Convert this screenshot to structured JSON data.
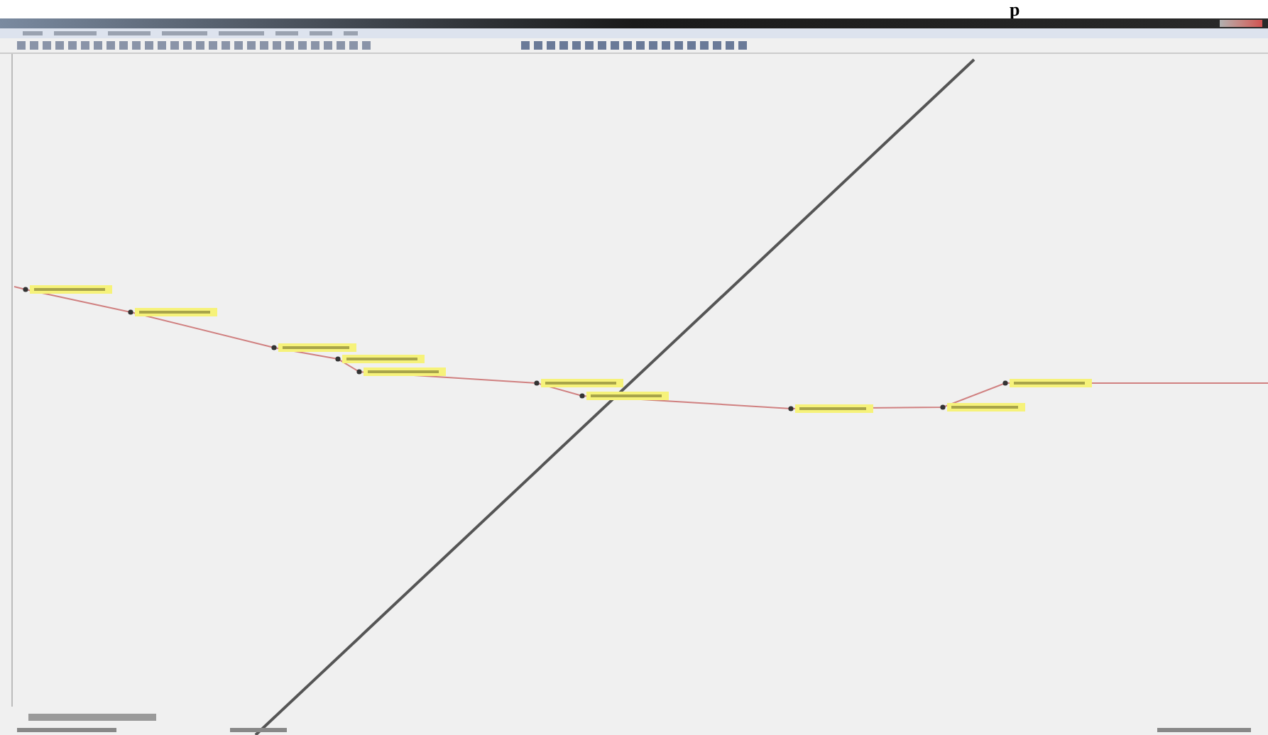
{
  "caption_fragment": "p",
  "stations": [
    {
      "kind": "marker"
    },
    {
      "kind": "marker"
    },
    {
      "kind": "marker"
    },
    {
      "kind": "marker"
    },
    {
      "kind": "marker"
    },
    {
      "kind": "marker"
    },
    {
      "kind": "marker"
    },
    {
      "kind": "marker"
    },
    {
      "kind": "marker"
    },
    {
      "kind": "marker"
    }
  ]
}
